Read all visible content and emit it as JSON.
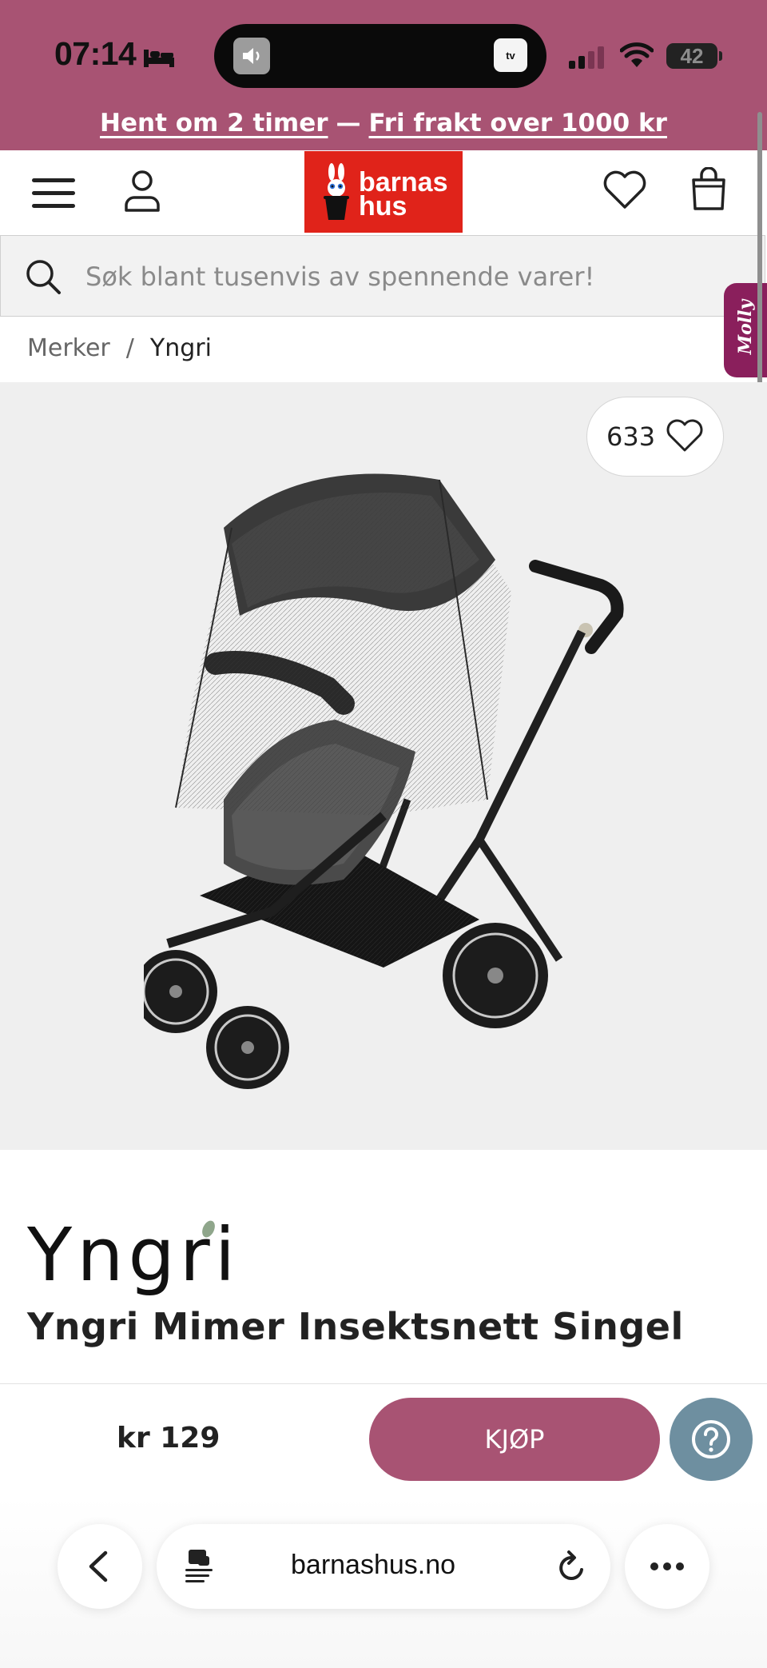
{
  "status_bar": {
    "time": "07:14",
    "app_badge": "tv",
    "battery": "42"
  },
  "promo": {
    "pickup_text": "Hent om 2 timer",
    "separator": "—",
    "shipping_text": "Fri frakt over 1000 kr"
  },
  "header": {
    "logo_line1": "barnas",
    "logo_line2": "hus"
  },
  "search": {
    "placeholder": "Søk blant tusenvis av spennende varer!"
  },
  "molly_tab": {
    "label": "Molly"
  },
  "breadcrumb": {
    "items": [
      "Merker",
      "Yngri"
    ],
    "separator": "/"
  },
  "product": {
    "like_count": "633",
    "brand": "Yngri",
    "title": "Yngri Mimer Insektsnett Singel",
    "price": "kr 129",
    "buy_label": "KJØP"
  },
  "browser": {
    "url": "barnashus.no"
  },
  "colors": {
    "brand_pink": "#a85373",
    "logo_red": "#e0231a",
    "help_blue": "#6e8fa0",
    "molly_purple": "#8a1f5c"
  },
  "icons": [
    "bed-icon",
    "speaker-icon",
    "signal-icon",
    "wifi-icon",
    "battery-icon",
    "menu-icon",
    "account-icon",
    "heart-icon",
    "bag-icon",
    "search-icon",
    "question-icon",
    "chevron-left-icon",
    "page-menu-icon",
    "reload-icon",
    "more-icon"
  ]
}
